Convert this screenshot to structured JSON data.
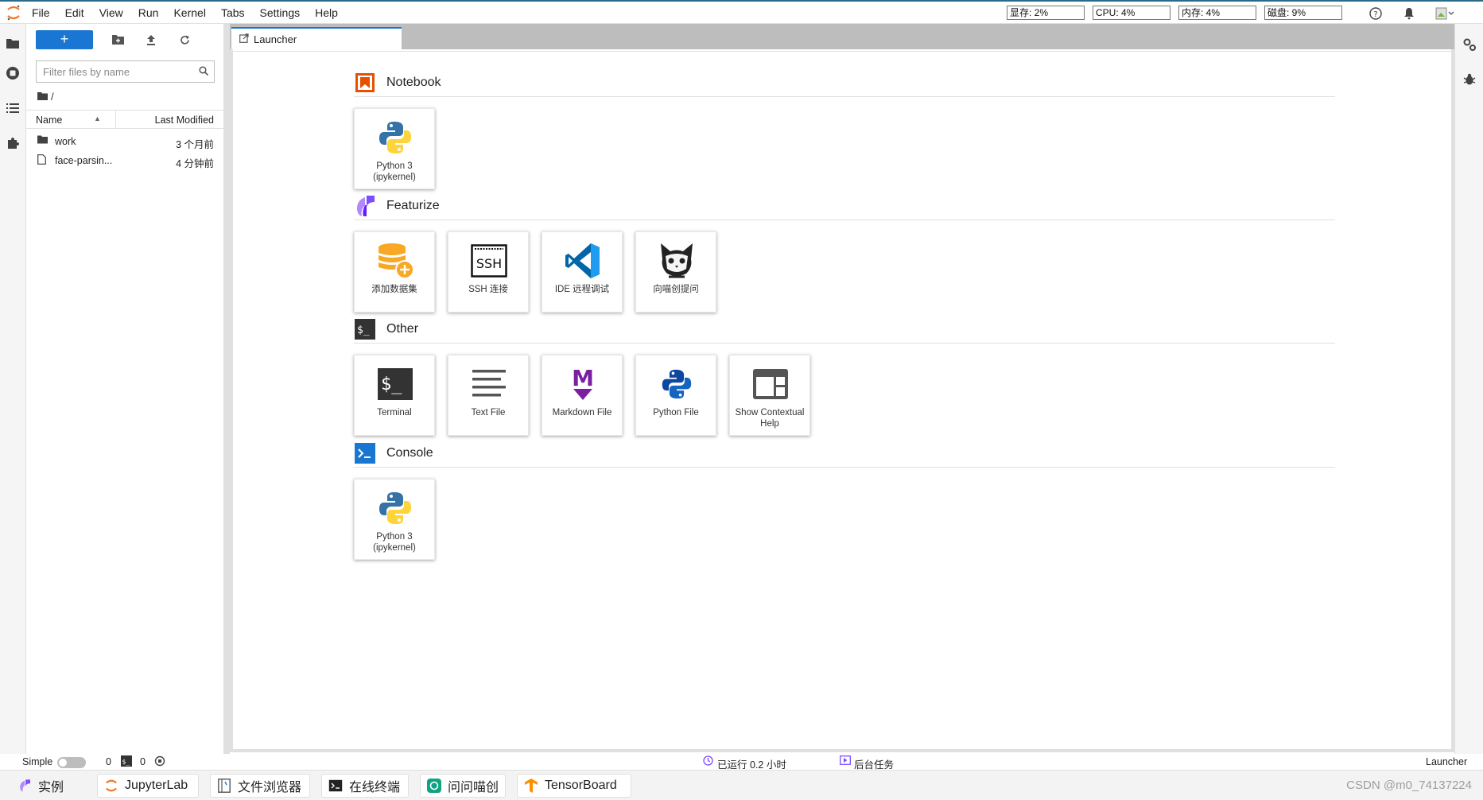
{
  "menu": [
    "File",
    "Edit",
    "View",
    "Run",
    "Kernel",
    "Tabs",
    "Settings",
    "Help"
  ],
  "metrics": [
    "显存: 2%",
    "CPU: 4%",
    "内存: 4%",
    "磁盘: 9%"
  ],
  "filebrowser": {
    "new_label": "+",
    "filter_placeholder": "Filter files by name",
    "breadcrumb": "/",
    "col_name": "Name",
    "col_modified": "Last Modified",
    "files": [
      {
        "name": "work",
        "modified": "3 个月前",
        "type": "folder"
      },
      {
        "name": "face-parsin...",
        "modified": "4 分钟前",
        "type": "file"
      }
    ]
  },
  "tab": {
    "label": "Launcher"
  },
  "launcher": {
    "sections": [
      {
        "title": "Notebook",
        "cards": [
          "Python 3\n(ipykernel)"
        ]
      },
      {
        "title": "Featurize",
        "cards": [
          "添加数据集",
          "SSH 连接",
          "IDE 远程调试",
          "向喵创提问"
        ]
      },
      {
        "title": "Other",
        "cards": [
          "Terminal",
          "Text File",
          "Markdown File",
          "Python File",
          "Show Contextual\nHelp"
        ]
      },
      {
        "title": "Console",
        "cards": [
          "Python 3\n(ipykernel)"
        ]
      }
    ]
  },
  "status": {
    "mode": "Simple",
    "kernels": "0",
    "terminals": "0",
    "runtime": "已运行 0.2 小时",
    "bg_tasks": "后台任务",
    "right": "Launcher"
  },
  "taskbar": {
    "items": [
      "实例",
      "JupyterLab",
      "文件浏览器",
      "在线终端",
      "问问喵创",
      "TensorBoard"
    ],
    "watermark": "CSDN @m0_74137224"
  },
  "colors": {
    "accent": "#1976d2",
    "notebook": "#e65100",
    "featurize": "#7c4dff",
    "markdown": "#7b1fa2",
    "python_blue": "#3572a5",
    "python_yellow": "#ffd43b",
    "vscode": "#007acc"
  }
}
